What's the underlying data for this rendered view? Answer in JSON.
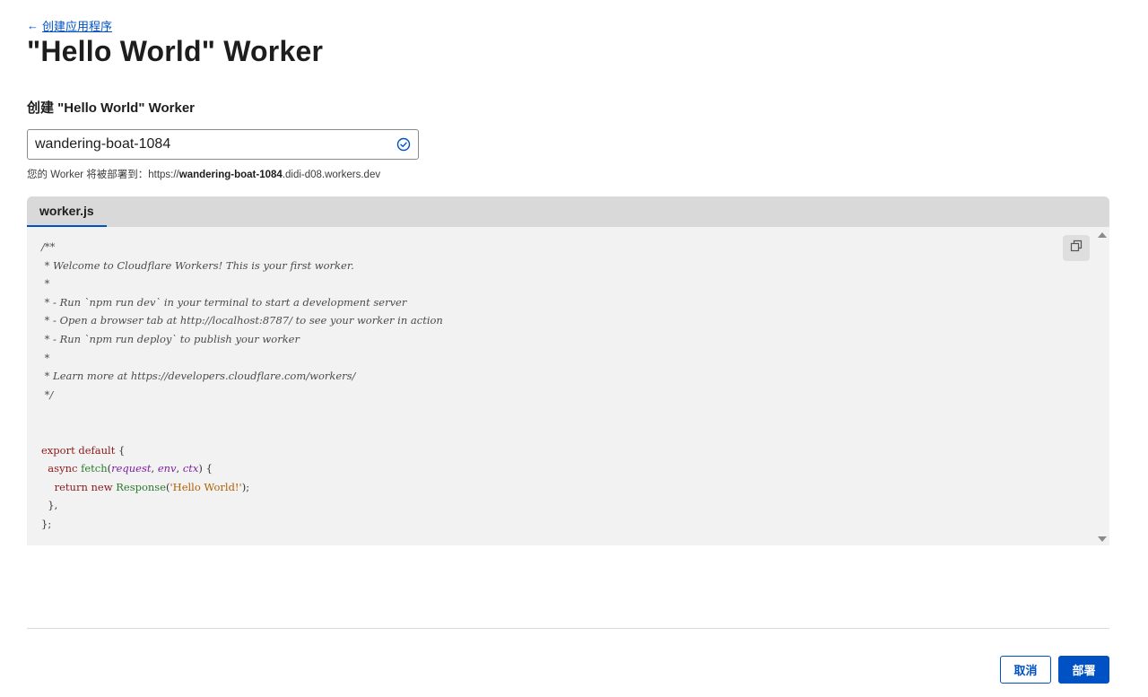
{
  "nav": {
    "back_arrow": "←",
    "back_label": "创建应用程序"
  },
  "page": {
    "title": "\"Hello World\" Worker",
    "section_title": "创建 \"Hello World\" Worker"
  },
  "form": {
    "worker_name_value": "wandering-boat-1084",
    "validation_icon": "check-circle-icon",
    "deploy_hint_prefix": "您的 Worker 将被部署到：https://",
    "deploy_hint_name": "wandering-boat-1084",
    "deploy_hint_suffix": ".didi-d08.workers.dev"
  },
  "editor": {
    "tab_label": "worker.js",
    "copy_icon": "copy-icon",
    "code": {
      "c1": "/**",
      "c2": " * Welcome to Cloudflare Workers! This is your first worker.",
      "c3": " *",
      "c4": " * - Run `npm run dev` in your terminal to start a development server",
      "c5": " * - Open a browser tab at http://localhost:8787/ to see your worker in action",
      "c6": " * - Run `npm run deploy` to publish your worker",
      "c7": " *",
      "c8": " * Learn more at https://developers.cloudflare.com/workers/",
      "c9": " */",
      "export_kw": "export default",
      "open_brace": " {",
      "async_kw": "  async",
      "fetch_fn": " fetch",
      "paren_open": "(",
      "param_request": "request",
      "comma1": ", ",
      "param_env": "env",
      "comma2": ", ",
      "param_ctx": "ctx",
      "paren_close_brace": ") {",
      "return_kw": "    return new",
      "response_class": " Response",
      "str_open": "(",
      "str_val": "'Hello World!'",
      "str_close": ");",
      "close_method": "  },",
      "close_obj": "};"
    }
  },
  "actions": {
    "cancel_label": "取消",
    "deploy_label": "部署"
  },
  "colors": {
    "accent": "#0051c3",
    "editor_bg": "#f2f2f2",
    "tab_bar_bg": "#d9d9d9"
  }
}
